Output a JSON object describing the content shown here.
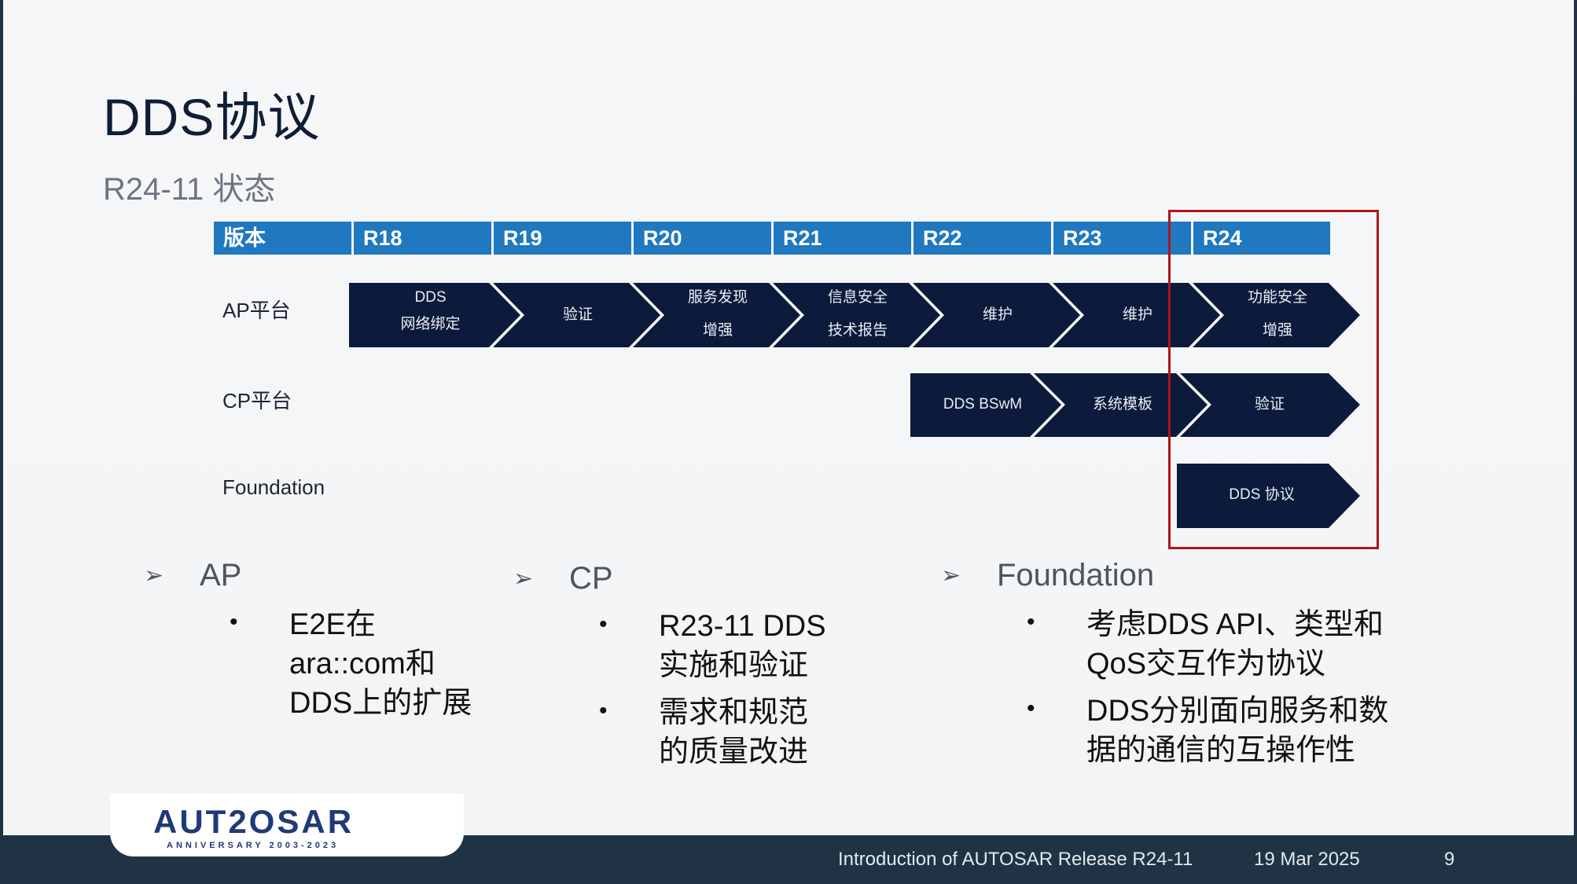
{
  "slide": {
    "title": "DDS协议",
    "subtitle": "R24-11 状态"
  },
  "table": {
    "headers": [
      "版本",
      "R18",
      "R19",
      "R20",
      "R21",
      "R22",
      "R23",
      "R24"
    ],
    "rows": [
      {
        "label": "AP平台",
        "steps": [
          {
            "l1": "DDS",
            "l2": "网络绑定"
          },
          {
            "l1": "验证",
            "l2": ""
          },
          {
            "l1": "服务发现",
            "l2": "增强"
          },
          {
            "l1": "信息安全",
            "l2": "技术报告"
          },
          {
            "l1": "维护",
            "l2": ""
          },
          {
            "l1": "维护",
            "l2": ""
          },
          {
            "l1": "功能安全",
            "l2": "增强"
          }
        ]
      },
      {
        "label": "CP平台",
        "steps": [
          {
            "l1": "DDS BSwM",
            "l2": ""
          },
          {
            "l1": "系统模板",
            "l2": ""
          },
          {
            "l1": "验证",
            "l2": ""
          }
        ]
      },
      {
        "label": "Foundation",
        "steps": [
          {
            "l1": "DDS 协议",
            "l2": ""
          }
        ]
      }
    ],
    "colors": {
      "header": "#1f78c0",
      "chevron": "#0c1a3b",
      "highlight": "#b0141b"
    }
  },
  "columns": [
    {
      "heading": "AP",
      "bullets": [
        "E2E在\nara::com和\nDDS上的扩展"
      ]
    },
    {
      "heading": "CP",
      "bullets": [
        "R23-11 DDS\n实施和验证",
        "需求和规范\n的质量改进"
      ]
    },
    {
      "heading": "Foundation",
      "bullets": [
        "考虑DDS API、类型和\nQoS交互作为协议",
        "DDS分别面向服务和数\n据的通信的互操作性"
      ]
    }
  ],
  "footer": {
    "presentation": "Introduction of AUTOSAR Release R24-11",
    "date": "19 Mar 2025",
    "page": "9"
  },
  "logo": {
    "name": "AUT2OSAR",
    "tagline": "ANNIVERSARY 2003-2023"
  }
}
